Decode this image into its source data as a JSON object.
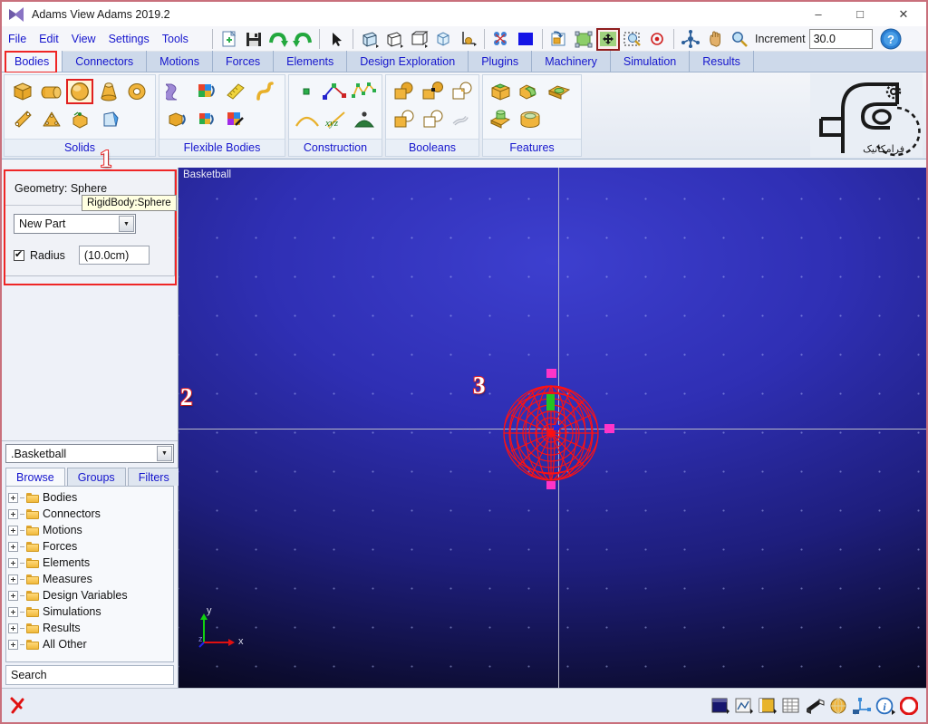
{
  "window": {
    "title": "Adams View Adams 2019.2",
    "app_icon": "adams-logo-icon",
    "minimize": "–",
    "maximize": "□",
    "close": "✕"
  },
  "menubar": {
    "items": [
      "File",
      "Edit",
      "View",
      "Settings",
      "Tools"
    ]
  },
  "toolbar": {
    "buttons": [
      {
        "name": "new-file-icon",
        "tip": "New"
      },
      {
        "name": "save-icon",
        "tip": "Save"
      },
      {
        "name": "redo-icon",
        "tip": "Redo"
      },
      {
        "name": "undo-icon",
        "tip": "Undo"
      },
      {
        "name": "select-arrow-icon",
        "tip": "Select"
      },
      {
        "name": "front-view-icon",
        "tip": "Front View"
      },
      {
        "name": "iso-view-icon",
        "tip": "Isometric View"
      },
      {
        "name": "box-view-icon",
        "tip": "Box View"
      },
      {
        "name": "render-shaded-icon",
        "tip": "Shaded"
      },
      {
        "name": "working-grid-icon",
        "tip": "Working Grid"
      },
      {
        "name": "pattern-icon",
        "tip": "Pattern"
      },
      {
        "name": "background-color-icon",
        "tip": "Background Color"
      },
      {
        "name": "view-rotate-icon",
        "tip": "Rotate View"
      },
      {
        "name": "fit-view-icon",
        "tip": "Fit to View"
      },
      {
        "name": "translate-icon",
        "tip": "Translate"
      },
      {
        "name": "zoom-box-icon",
        "tip": "Zoom Box"
      },
      {
        "name": "center-icon",
        "tip": "Center"
      },
      {
        "name": "dynamic-rotate-icon",
        "tip": "Dynamic Rotate"
      },
      {
        "name": "pan-hand-icon",
        "tip": "Pan"
      },
      {
        "name": "zoom-icon",
        "tip": "Zoom"
      }
    ],
    "increment_label": "Increment",
    "increment_value": "30.0",
    "help_label": "?"
  },
  "ribbon_tabs": {
    "items": [
      "Bodies",
      "Connectors",
      "Motions",
      "Forces",
      "Elements",
      "Design Exploration",
      "Plugins",
      "Machinery",
      "Simulation",
      "Results"
    ],
    "active": "Bodies",
    "highlight_color": "#ef2626"
  },
  "ribbon": {
    "groups": [
      {
        "label": "Solids",
        "row1": [
          "rigidbody-box-icon",
          "rigidbody-cylinder-icon",
          "rigidbody-sphere-icon",
          "rigidbody-frustum-icon",
          "rigidbody-torus-icon"
        ],
        "row2": [
          "rigidbody-link-icon",
          "rigidbody-plate-icon",
          "rigidbody-extrusion-icon",
          "rigidbody-revolution-icon"
        ],
        "selected_icon": "rigidbody-sphere-icon"
      },
      {
        "label": "Flexible Bodies",
        "row1": [
          "flex-body-icon",
          "rigid-to-flex-icon",
          "flex-beam-icon",
          "flex-spline-icon"
        ],
        "row2": [
          "flex-import-icon",
          "flex-to-rigid-icon",
          "flex-edit-icon"
        ]
      },
      {
        "label": "Construction",
        "row1": [
          "marker-point-icon",
          "polyline-icon",
          "spline-icon"
        ],
        "row2": [
          "arc-icon",
          "xyz-csys-icon",
          "contour-icon"
        ]
      },
      {
        "label": "Booleans",
        "row1": [
          "boolean-unite-icon",
          "boolean-merge-icon",
          "boolean-intersect-icon"
        ],
        "row2": [
          "boolean-subtract-icon",
          "boolean-cut-icon",
          "boolean-chain-icon"
        ]
      },
      {
        "label": "Features",
        "row1": [
          "feature-fillet-icon",
          "feature-chamfer-icon",
          "feature-hollow-icon"
        ],
        "row2": [
          "feature-boss-icon",
          "feature-hole-icon"
        ]
      }
    ],
    "logo_alt": "faramechanic-logo"
  },
  "tooltip": {
    "text": "RigidBody:Sphere"
  },
  "geometry_panel": {
    "title": "Geometry: Sphere",
    "part_select_value": "New Part",
    "radius_checked": true,
    "radius_label": "Radius",
    "radius_value": "(10.0cm)",
    "highlight_color": "#ef2626"
  },
  "browser": {
    "model_select_value": ".Basketball",
    "tabs": [
      "Browse",
      "Groups",
      "Filters"
    ],
    "active_tab": "Browse",
    "tree": [
      "Bodies",
      "Connectors",
      "Motions",
      "Forces",
      "Elements",
      "Measures",
      "Design Variables",
      "Simulations",
      "Results",
      "All Other"
    ],
    "search_placeholder": "Search"
  },
  "viewport": {
    "label": "Basketball",
    "model_name": "Basketball",
    "sphere_color": "#ff1111",
    "grid_cross_color": "#b9b9c9",
    "triad": {
      "x_label": "x",
      "x_color": "#e01010",
      "y_label": "y",
      "y_color": "#11d011",
      "z_label": "z",
      "z_color": "#2222ee"
    },
    "handles": {
      "top_color": "#ff34c8",
      "right_color": "#ff34c8",
      "center_marker_color": "#22cc22"
    }
  },
  "annotations": [
    {
      "id": "1",
      "target": "rigidbody-sphere-icon"
    },
    {
      "id": "2",
      "target": "geometry-panel"
    },
    {
      "id": "3",
      "target": "sphere-in-viewport"
    }
  ],
  "statusbar": {
    "left_icon": "red-cursor-icon",
    "message": "",
    "buttons": [
      "grid-display-icon",
      "plot-icon",
      "color-fill-icon",
      "table-icon",
      "wedge-icon",
      "sphere-render-icon",
      "coordinate-icon",
      "info-icon",
      "stop-icon"
    ]
  }
}
